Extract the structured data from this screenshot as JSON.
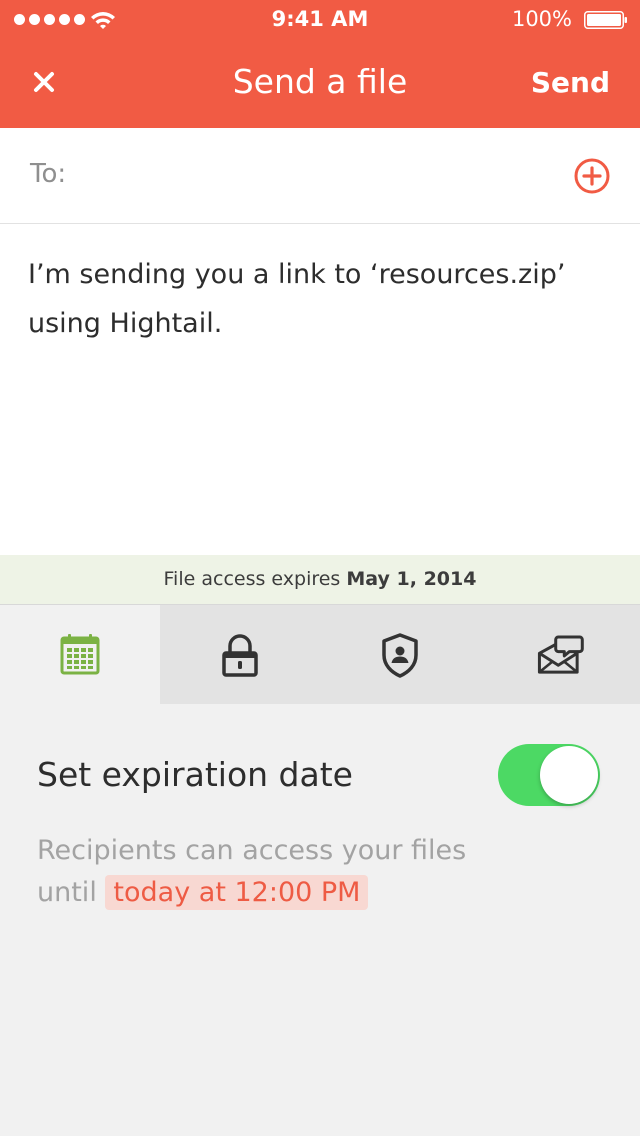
{
  "status_bar": {
    "time": "9:41 AM",
    "battery_percent": "100%",
    "battery_level": 1.0
  },
  "navbar": {
    "close_icon": "close-icon",
    "title": "Send a file",
    "send_label": "Send"
  },
  "recipients": {
    "label": "To:",
    "add_icon": "plus-circle-icon"
  },
  "message": {
    "line1": "I’m sending you a link to ‘resources.zip’",
    "line2": "using Hightail."
  },
  "expiry_banner": {
    "prefix": "File access expires",
    "date": "May 1, 2014"
  },
  "tabs": [
    {
      "icon": "calendar-icon",
      "active": true
    },
    {
      "icon": "lock-icon",
      "active": false
    },
    {
      "icon": "shield-user-icon",
      "active": false
    },
    {
      "icon": "envelope-chat-icon",
      "active": false
    }
  ],
  "expiration_setting": {
    "label": "Set expiration date",
    "enabled": true,
    "description_line1": "Recipients can access your files",
    "description_prefix": "until",
    "description_highlight": "today at 12:00 PM"
  },
  "colors": {
    "brand": "#f15b44",
    "toggle_on": "#4cd964",
    "calendar_active": "#7bb244",
    "highlight_bg": "#f8d8d2"
  }
}
